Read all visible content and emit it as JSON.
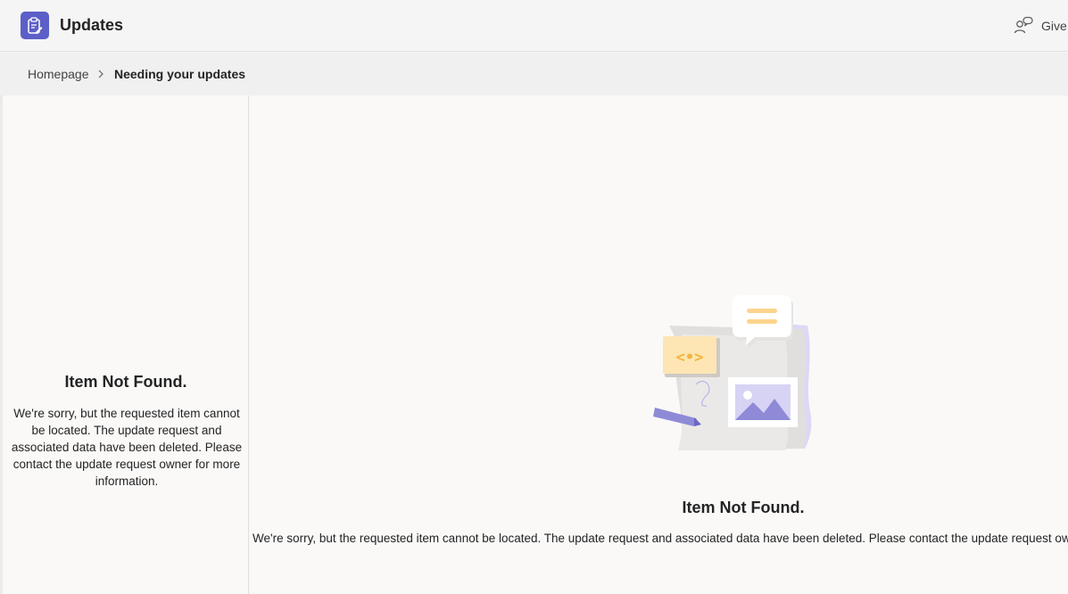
{
  "app": {
    "title": "Updates",
    "icon": "clipboard-edit-icon",
    "accent_color": "#5b5fc7"
  },
  "header": {
    "feedback_label": "Give",
    "feedback_icon": "feedback-people-icon"
  },
  "breadcrumb": {
    "home": "Homepage",
    "separator_icon": "chevron-right-icon",
    "current": "Needing your updates"
  },
  "left_pane": {
    "heading": "Item Not Found.",
    "message": "We're sorry, but the requested item cannot be located. The update request and associated data have been deleted. Please contact the update request owner for more information."
  },
  "main_pane": {
    "illustration": "empty-state-illustration",
    "heading": "Item Not Found.",
    "message": "We're sorry, but the requested item cannot be located. The update request and associated data have been deleted. Please contact the update request owner for more information."
  }
}
